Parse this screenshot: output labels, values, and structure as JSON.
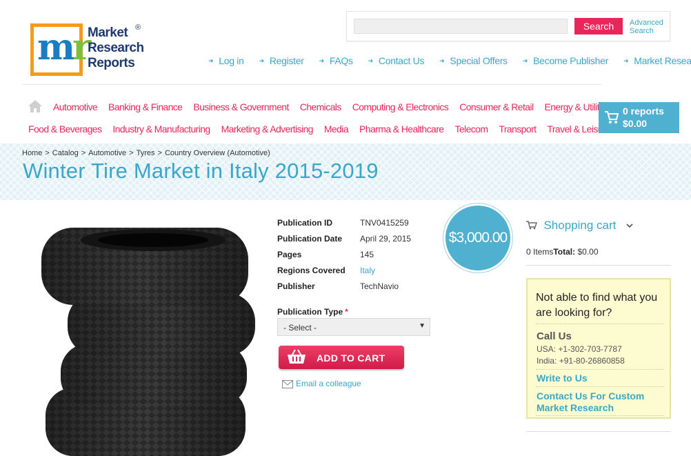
{
  "brand": {
    "line1": "Market",
    "line2": "Research",
    "line3": "Reports",
    "reg": "®"
  },
  "search": {
    "placeholder": "",
    "button": "Search",
    "advanced": "Advanced Search"
  },
  "top_links": [
    "Log in",
    "Register",
    "FAQs",
    "Contact Us",
    "Special Offers",
    "Become Publisher",
    "Market Research Blog"
  ],
  "nav": {
    "row1": [
      "Automotive",
      "Banking & Finance",
      "Business & Government",
      "Chemicals",
      "Computing & Electronics",
      "Consumer & Retail",
      "Energy & Utilities"
    ],
    "row2": [
      "Food & Beverages",
      "Industry & Manufacturing",
      "Marketing & Advertising",
      "Media",
      "Pharma & Healthcare",
      "Telecom",
      "Transport",
      "Travel & Leisure"
    ]
  },
  "cart_header": {
    "count": "0 reports",
    "total": "$0.00"
  },
  "breadcrumb": [
    "Home",
    "Catalog",
    "Automotive",
    "Tyres",
    "Country Overview (Automotive)"
  ],
  "title": "Winter Tire Market in Italy 2015-2019",
  "details": {
    "pub_id_label": "Publication ID",
    "pub_id": "TNV0415259",
    "date_label": "Publication Date",
    "date": "April 29, 2015",
    "pages_label": "Pages",
    "pages": "145",
    "regions_label": "Regions Covered",
    "regions": "Italy",
    "publisher_label": "Publisher",
    "publisher": "TechNavio"
  },
  "price": "$3,000.00",
  "pub_type": {
    "label": "Publication Type",
    "required": "*",
    "selected": "- Select -"
  },
  "add_to_cart": "ADD TO CART",
  "email_colleague": "Email a colleague",
  "shopping_cart": {
    "title": "Shopping cart",
    "items": "0 Items",
    "total_label": "Total:",
    "total": "$0.00"
  },
  "help": {
    "question": "Not able to find what you are looking for?",
    "call_us": "Call Us",
    "usa": "USA: +1-302-703-7787",
    "india": "India: +91-80-26860858",
    "write": "Write to Us",
    "custom": "Contact Us For Custom Market Research"
  },
  "colors": {
    "accent": "#3aa7c9",
    "pink": "#e9265a",
    "cart": "#4fb0cf"
  }
}
